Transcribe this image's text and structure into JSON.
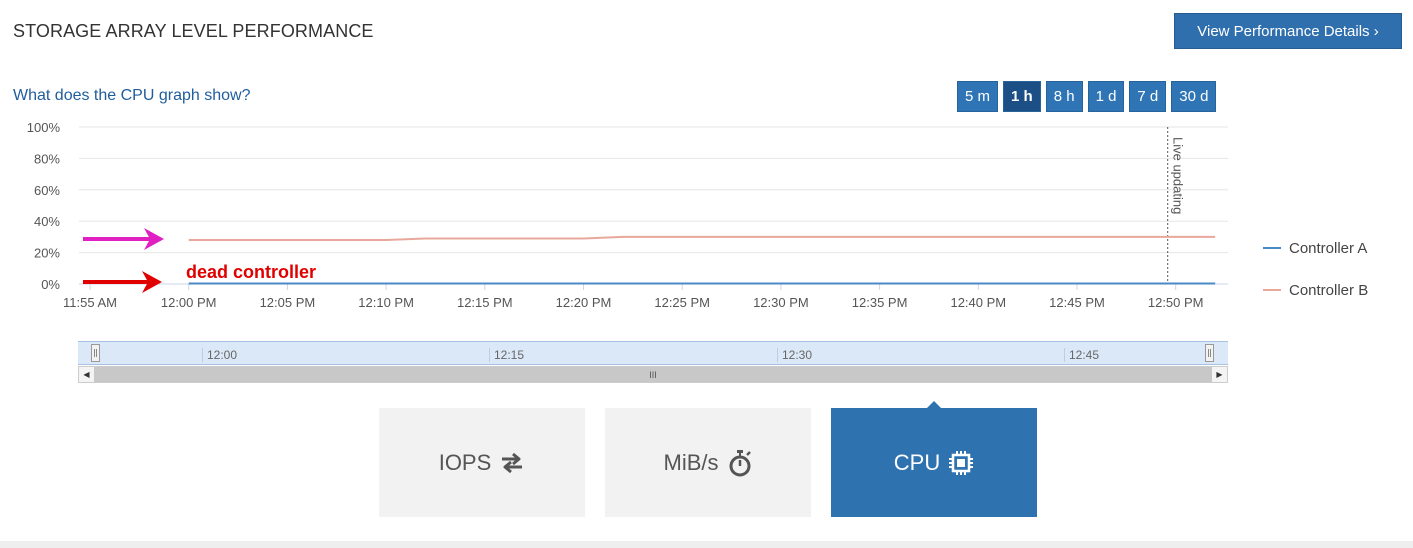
{
  "header": {
    "title": "STORAGE ARRAY LEVEL PERFORMANCE",
    "details_button": "View Performance Details ›"
  },
  "help_link": "What does the CPU graph show?",
  "time_ranges": [
    {
      "label": "5 m",
      "active": false
    },
    {
      "label": "1 h",
      "active": true
    },
    {
      "label": "8 h",
      "active": false
    },
    {
      "label": "1 d",
      "active": false
    },
    {
      "label": "7 d",
      "active": false
    },
    {
      "label": "30 d",
      "active": false
    }
  ],
  "chart_data": {
    "type": "line",
    "ylim": [
      0,
      100
    ],
    "yticks": [
      "100%",
      "80%",
      "60%",
      "40%",
      "20%",
      "0%"
    ],
    "xticks": [
      "11:55 AM",
      "12:00 PM",
      "12:05 PM",
      "12:10 PM",
      "12:15 PM",
      "12:20 PM",
      "12:25 PM",
      "12:30 PM",
      "12:35 PM",
      "12:40 PM",
      "12:45 PM",
      "12:50 PM"
    ],
    "live_marker": {
      "label": "Live updating",
      "time": "12:50 PM"
    },
    "series": [
      {
        "name": "Controller A",
        "color": "#4a8ac4",
        "points": [
          [
            "12:00 PM",
            0
          ],
          [
            "12:10 PM",
            0
          ],
          [
            "12:20 PM",
            0
          ],
          [
            "12:30 PM",
            0
          ],
          [
            "12:40 PM",
            0
          ],
          [
            "12:50 PM",
            0
          ],
          [
            "12:52 PM",
            0
          ]
        ]
      },
      {
        "name": "Controller B",
        "color": "#eaa89c",
        "points": [
          [
            "12:00 PM",
            28
          ],
          [
            "12:05 PM",
            28
          ],
          [
            "12:10 PM",
            28
          ],
          [
            "12:12 PM",
            29
          ],
          [
            "12:15 PM",
            29
          ],
          [
            "12:20 PM",
            29
          ],
          [
            "12:22 PM",
            30
          ],
          [
            "12:25 PM",
            30
          ],
          [
            "12:30 PM",
            30
          ],
          [
            "12:40 PM",
            30
          ],
          [
            "12:50 PM",
            30
          ],
          [
            "12:52 PM",
            30
          ]
        ]
      }
    ],
    "annotations": [
      {
        "text": "dead controller",
        "color": "#e00000"
      }
    ]
  },
  "navigator": {
    "ticks": [
      "12:00",
      "12:15",
      "12:30",
      "12:45"
    ],
    "thumb_grip": "III"
  },
  "metric_tiles": [
    {
      "label": "IOPS",
      "icon": "swap-arrows-icon",
      "active": false
    },
    {
      "label": "MiB/s",
      "icon": "stopwatch-icon",
      "active": false
    },
    {
      "label": "CPU",
      "icon": "cpu-chip-icon",
      "active": true
    }
  ],
  "colors": {
    "primary": "#2f72b0",
    "active_range": "#1b4f86",
    "arrow_magenta": "#e020c0",
    "arrow_red": "#e00000"
  }
}
